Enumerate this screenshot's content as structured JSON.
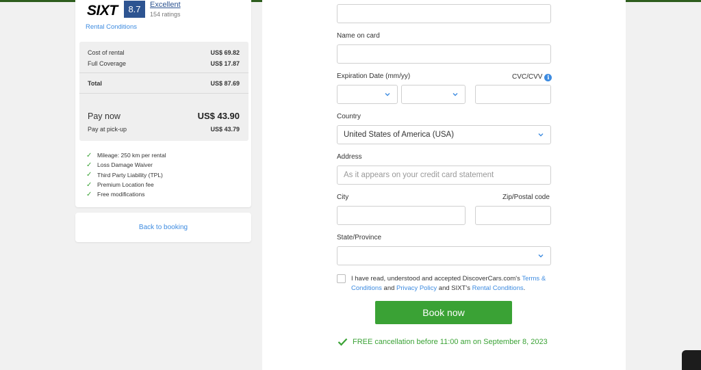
{
  "summary": {
    "brand": "SIXT",
    "score": "8.7",
    "rating_word": "Excellent",
    "rating_count": "154 ratings",
    "rental_conditions": "Rental Conditions",
    "cost_label": "Cost of rental",
    "cost_value": "US$ 69.82",
    "coverage_label": "Full Coverage",
    "coverage_value": "US$ 17.87",
    "total_label": "Total",
    "total_value": "US$ 87.69",
    "pay_now_label": "Pay now",
    "pay_now_value": "US$ 43.90",
    "pay_pickup_label": "Pay at pick-up",
    "pay_pickup_value": "US$ 43.79",
    "features": [
      "Mileage: 250 km per rental",
      "Loss Damage Waiver",
      "Third Party Liability (TPL)",
      "Premium Location fee",
      "Free modifications"
    ],
    "back_link": "Back to booking"
  },
  "form": {
    "name_label": "Name on card",
    "expiry_label": "Expiration Date (mm/yy)",
    "cvc_label": "CVC/CVV",
    "country_label": "Country",
    "country_value": "United States of America (USA)",
    "address_label": "Address",
    "address_placeholder": "As it appears on your credit card statement",
    "city_label": "City",
    "zip_label": "Zip/Postal code",
    "state_label": "State/Province",
    "terms_prefix": "I have read, understood and accepted DiscoverCars.com's",
    "terms_link": "Terms & Conditions",
    "terms_and": "and",
    "privacy_link": "Privacy Policy",
    "terms_and2": "and SIXT's",
    "rental_link": "Rental Conditions",
    "terms_end": ".",
    "book_button": "Book now",
    "free_cancel": "FREE cancellation before 11:00 am on September 8, 2023"
  },
  "colors": {
    "accent_green": "#3aa235",
    "link_blue": "#3d8be0",
    "badge_blue": "#2d5491"
  }
}
